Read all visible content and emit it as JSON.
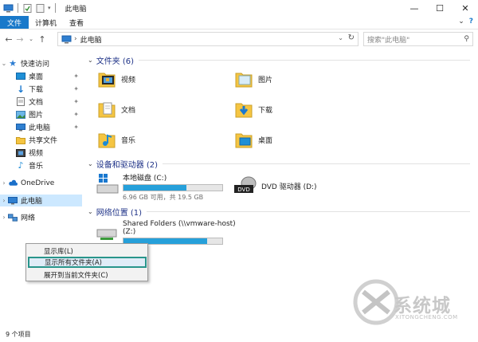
{
  "window": {
    "title": "此电脑",
    "minimize": "—",
    "maximize": "☐",
    "close": "✕"
  },
  "ribbon": {
    "tabs": [
      "文件",
      "计算机",
      "查看"
    ],
    "collapse": "⌄",
    "help": "?"
  },
  "address": {
    "crumb": "此电脑",
    "search_placeholder": "搜索\"此电脑\""
  },
  "nav": {
    "quick_access": "快速访问",
    "items": [
      "桌面",
      "下载",
      "文档",
      "图片",
      "此电脑",
      "共享文件",
      "视频",
      "音乐"
    ],
    "onedrive": "OneDrive",
    "this_pc": "此电脑",
    "network": "网络"
  },
  "main": {
    "folders_header": "文件夹 (6)",
    "folders": [
      "视频",
      "图片",
      "文档",
      "下载",
      "音乐",
      "桌面"
    ],
    "drives_header": "设备和驱动器 (2)",
    "local_disk": {
      "name": "本地磁盘 (C:)",
      "info": "6.96 GB 可用，共 19.5 GB",
      "used_fraction": 0.64
    },
    "dvd": {
      "name": "DVD 驱动器 (D:)",
      "badge": "DVD"
    },
    "network_header": "网络位置 (1)",
    "share": {
      "name": "Shared Folders (\\\\vmware-host)",
      "letter": "(Z:)",
      "used_fraction": 0.85
    }
  },
  "context_menu": [
    "显示库(L)",
    "显示所有文件夹(A)",
    "展开到当前文件夹(C)"
  ],
  "status": {
    "count": "9 个项目"
  },
  "watermark": {
    "text": "系统城",
    "sub": "XITONGCHENG.COM"
  },
  "colors": {
    "accent": "#1979ca",
    "bar": "#26a0da",
    "highlight_border": "#28958b",
    "selected": "#cce8ff"
  }
}
